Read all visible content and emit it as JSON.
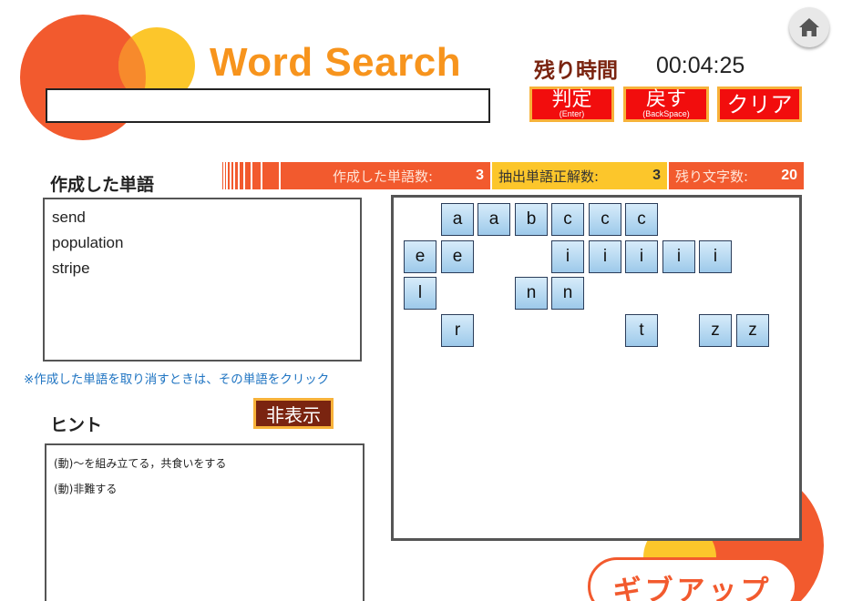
{
  "app": {
    "title": "Word Search"
  },
  "input": {
    "value": "",
    "placeholder": ""
  },
  "timer": {
    "label": "残り時間",
    "value": "00:04:25"
  },
  "buttons": {
    "judge": {
      "label": "判定",
      "sub": "(Enter)"
    },
    "undo": {
      "label": "戻す",
      "sub": "(BackSpace)"
    },
    "clear": {
      "label": "クリア"
    },
    "toggle_hint": "非表示",
    "give_up": "ギブアップ"
  },
  "stats": {
    "created": {
      "label": "作成した単語数:",
      "value": "3"
    },
    "correct": {
      "label": "抽出単語正解数:",
      "value": "3"
    },
    "remaining": {
      "label": "残り文字数:",
      "value": "20"
    }
  },
  "created_words": {
    "heading": "作成した単語",
    "items": [
      "send",
      "population",
      "stripe"
    ],
    "note": "※作成した単語を取り消すときは、その単語をクリック"
  },
  "hint": {
    "heading": "ヒント",
    "items": [
      "(動)〜を組み立てる，共食いをする",
      "(動)非難する"
    ]
  },
  "letter_tiles": [
    {
      "letter": "a",
      "row": 0,
      "col": 1
    },
    {
      "letter": "a",
      "row": 0,
      "col": 2
    },
    {
      "letter": "b",
      "row": 0,
      "col": 3
    },
    {
      "letter": "c",
      "row": 0,
      "col": 4
    },
    {
      "letter": "c",
      "row": 0,
      "col": 5
    },
    {
      "letter": "c",
      "row": 0,
      "col": 6
    },
    {
      "letter": "e",
      "row": 1,
      "col": 0
    },
    {
      "letter": "e",
      "row": 1,
      "col": 1
    },
    {
      "letter": "i",
      "row": 1,
      "col": 4
    },
    {
      "letter": "i",
      "row": 1,
      "col": 5
    },
    {
      "letter": "i",
      "row": 1,
      "col": 6
    },
    {
      "letter": "i",
      "row": 1,
      "col": 7
    },
    {
      "letter": "i",
      "row": 1,
      "col": 8
    },
    {
      "letter": "l",
      "row": 2,
      "col": 0
    },
    {
      "letter": "n",
      "row": 2,
      "col": 3
    },
    {
      "letter": "n",
      "row": 2,
      "col": 4
    },
    {
      "letter": "r",
      "row": 3,
      "col": 1
    },
    {
      "letter": "t",
      "row": 3,
      "col": 6
    },
    {
      "letter": "z",
      "row": 3,
      "col": 8
    },
    {
      "letter": "z",
      "row": 3,
      "col": 9
    }
  ],
  "colors": {
    "accent_red": "#f25a2e",
    "accent_yellow": "#fcc62b",
    "title_orange": "#f7941d",
    "button_red": "#f20d0d",
    "dark_brown": "#7a2410",
    "note_blue": "#1f74c2"
  },
  "icons": {
    "home": "home-icon"
  }
}
